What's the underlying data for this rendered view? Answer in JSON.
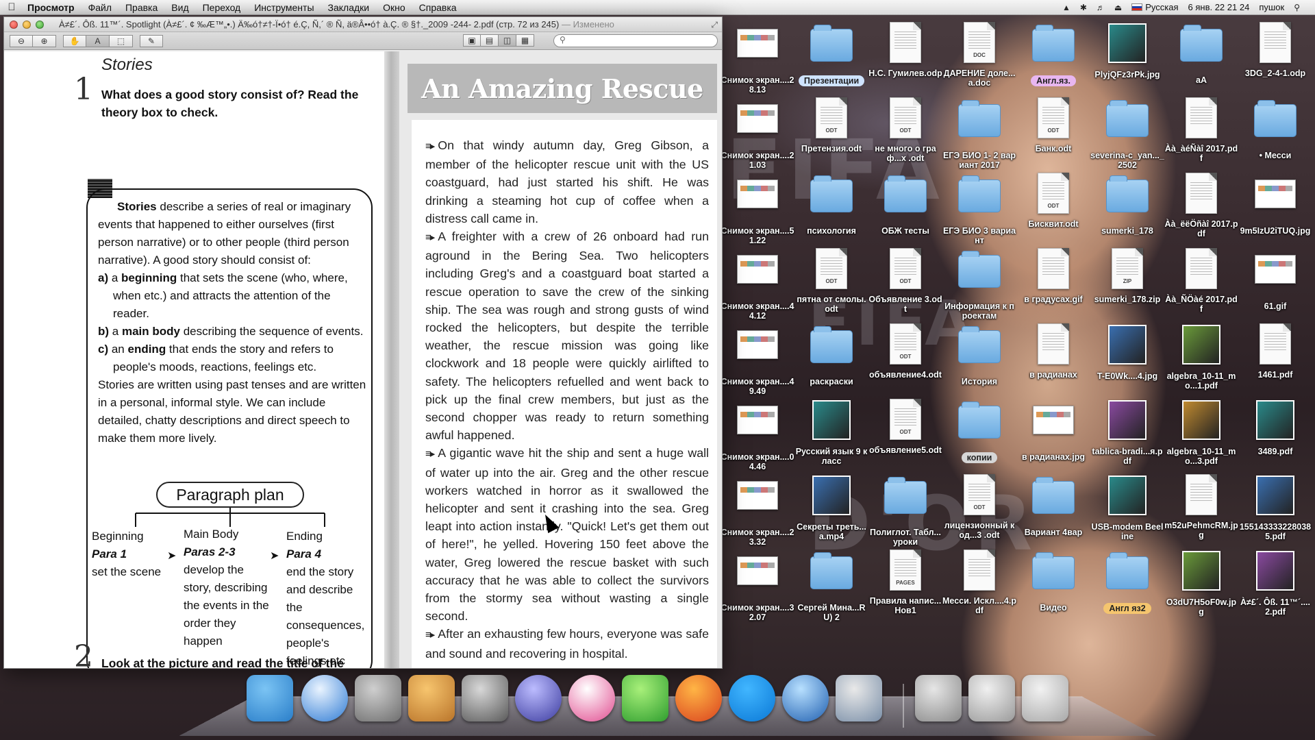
{
  "menubar": {
    "app": "Просмотр",
    "items": [
      "Файл",
      "Правка",
      "Вид",
      "Переход",
      "Инструменты",
      "Закладки",
      "Окно",
      "Справка"
    ],
    "input_source": "Русская",
    "datetime": "6 янв. 22 21 24",
    "user": "пушок"
  },
  "window": {
    "title": "À≠£´. Ôß. 11™´. Spotlight (À≠£´. ¢ ‰Æ™„•.) Ä‰ó†≠†-Ï•ó† é.Ç, Ñ,´ ® Ñ, ä®Â••ó† à.Ç. ® §†._2009 -244- 2.pdf (стр. 72 из 245)",
    "edited": "— Изменено",
    "search_placeholder": ""
  },
  "left_page": {
    "section": "Stories",
    "ex1_num": "1",
    "ex1_text": "What does a good story consist of? Read the theory box to check.",
    "theory": {
      "intro_bold": "Stories",
      "intro": " describe a series of real or imaginary events that happened to either ourselves (first person narrative) or to other people (third person narrative). A good story should consist of:",
      "a_label": "a)",
      "a_pre": " a ",
      "a_bold": "beginning",
      "a_rest": " that sets the scene (who, where, when etc.) and attracts the attention of the reader.",
      "b_label": "b)",
      "b_pre": " a ",
      "b_bold": "main body",
      "b_rest": " describing the sequence of events.",
      "c_label": "c)",
      "c_pre": " an ",
      "c_bold": "ending",
      "c_rest": " that ends the story and refers to people's moods, reactions, feelings etc.",
      "outro": "Stories are written using past tenses and are written in a personal, informal style. We can include detailed, chatty descriptions and direct speech to make them more lively."
    },
    "plan_title": "Paragraph plan",
    "col1": {
      "head": "Beginning",
      "para": "Para 1",
      "desc": "set the scene"
    },
    "col2": {
      "head": "Main Body",
      "para": "Paras 2-3",
      "desc": "develop the story, describing the events in the order they happen"
    },
    "col3": {
      "head": "Ending",
      "para": "Para 4",
      "desc": "end the story and describe the consequences, people's feelings etc"
    },
    "ex2_num": "2",
    "ex2_text": "Look at the picture and read the title of the story and the first paragraph. Where does the"
  },
  "right_page": {
    "title": "An Amazing Rescue",
    "p1": "On that windy autumn day, Greg Gibson, a member of the helicopter rescue unit with the US coastguard, had just started his shift. He was drinking a steaming hot cup of coffee when a distress call came in.",
    "p2": "A freighter with a crew of 26 onboard had run aground in the Bering Sea. Two helicopters including Greg's and a coastguard boat started a rescue operation to save the crew of the sinking ship. The sea was rough and strong gusts of wind rocked the helicopters, but despite the terrible weather, the rescue mission was going like clockwork and 18 people were quickly airlifted to safety. The helicopters refuelled and went back to pick up the final crew members, but just as the second chopper was ready to return something awful happened.",
    "p3": "A gigantic wave hit the ship and sent a huge wall of water up into the air. Greg and the other rescue workers watched in horror as it swallowed the helicopter and sent it crashing into the sea. Greg leapt into action instantly. \"Quick! Let's get them out of here!\", he yelled. Hovering 150 feet above the water, Greg lowered the rescue basket with such accuracy that he was able to collect the survivors from the stormy sea without wasting a single second.",
    "p4": "After an exhausting few hours, everyone was safe and sound and recovering in hospital."
  },
  "desktop_icons": [
    {
      "label": "Снимок экран....28.13",
      "type": "shot"
    },
    {
      "label": "Презентации",
      "type": "folder",
      "tag": "#cfe3ff"
    },
    {
      "label": "Н.С. Гумилев.odp",
      "type": "doc",
      "ext": ""
    },
    {
      "label": "ДАРЕНИЕ доле...a.doc",
      "type": "doc",
      "ext": "DOC"
    },
    {
      "label": "Англ.яз.",
      "type": "folder",
      "tag": "#e8b6f0"
    },
    {
      "label": "PlyjQFz3rPk.jpg",
      "type": "photo"
    },
    {
      "label": "аА",
      "type": "folder"
    },
    {
      "label": "3DG_2-4-1.odp",
      "type": "doc",
      "ext": ""
    },
    {
      "label": "Снимок экран....21.03",
      "type": "shot"
    },
    {
      "label": "Претензия.odt",
      "type": "doc",
      "ext": "ODT"
    },
    {
      "label": "не много о граф...x .odt",
      "type": "doc",
      "ext": "ODT"
    },
    {
      "label": "ЕГЭ БИО 1- 2 вариант 2017",
      "type": "folder"
    },
    {
      "label": "Банк.odt",
      "type": "doc",
      "ext": "ODT"
    },
    {
      "label": "severina-c_yan..._2502",
      "type": "folder"
    },
    {
      "label": "Àà_àéÑàî 2017.pdf",
      "type": "doc",
      "ext": ""
    },
    {
      "label": "• Месси",
      "type": "folder"
    },
    {
      "label": "Снимок экран....51.22",
      "type": "shot"
    },
    {
      "label": "психология",
      "type": "folder"
    },
    {
      "label": "ОБЖ тесты",
      "type": "folder"
    },
    {
      "label": "ЕГЭ БИО 3 вариант",
      "type": "folder"
    },
    {
      "label": "Бисквит.odt",
      "type": "doc",
      "ext": "ODT"
    },
    {
      "label": "sumerki_178",
      "type": "folder"
    },
    {
      "label": "Àà_ëëÖñàî 2017.pdf",
      "type": "doc",
      "ext": ""
    },
    {
      "label": "9m5IzU2iTUQ.jpg",
      "type": "shot"
    },
    {
      "label": "Снимок экран....44.12",
      "type": "shot"
    },
    {
      "label": "пятна от смолы.odt",
      "type": "doc",
      "ext": "ODT"
    },
    {
      "label": "Объявление 3.odt",
      "type": "doc",
      "ext": "ODT"
    },
    {
      "label": "Информация к проектам",
      "type": "folder"
    },
    {
      "label": "в градусах.gif",
      "type": "doc",
      "ext": ""
    },
    {
      "label": "sumerki_178.zip",
      "type": "doc",
      "ext": "ZIP"
    },
    {
      "label": "Àà_ÑÖàé 2017.pdf",
      "type": "doc",
      "ext": ""
    },
    {
      "label": "61.gif",
      "type": "shot"
    },
    {
      "label": "Снимок экран....49.49",
      "type": "shot"
    },
    {
      "label": "раскраски",
      "type": "folder"
    },
    {
      "label": "объявление4.odt",
      "type": "doc",
      "ext": "ODT"
    },
    {
      "label": "История",
      "type": "folder"
    },
    {
      "label": "в радианах",
      "type": "doc",
      "ext": ""
    },
    {
      "label": "T-E0Wk....4.jpg",
      "type": "photo"
    },
    {
      "label": "algebra_10-11_mo...1.pdf",
      "type": "photo"
    },
    {
      "label": "1461.pdf",
      "type": "doc",
      "ext": ""
    },
    {
      "label": "Снимок экран....04.46",
      "type": "shot"
    },
    {
      "label": "Русский язык 9 класс",
      "type": "photo"
    },
    {
      "label": "объявление5.odt",
      "type": "doc",
      "ext": "ODT"
    },
    {
      "label": "копии",
      "type": "folder",
      "tag": "#d6d6d6"
    },
    {
      "label": "в радианах.jpg",
      "type": "shot"
    },
    {
      "label": "tablica-bradi...я.pdf",
      "type": "photo"
    },
    {
      "label": "algebra_10-11_mo...3.pdf",
      "type": "photo"
    },
    {
      "label": "3489.pdf",
      "type": "photo"
    },
    {
      "label": "Снимок экран....23.32",
      "type": "shot"
    },
    {
      "label": "Секреты треть...a.mp4",
      "type": "photo"
    },
    {
      "label": "Полиглот. Табл...уроки",
      "type": "folder"
    },
    {
      "label": "лицензионный код...3 .odt",
      "type": "doc",
      "ext": "ODT"
    },
    {
      "label": "Вариант 4вар",
      "type": "folder"
    },
    {
      "label": "USB-modem Beeline",
      "type": "photo"
    },
    {
      "label": "m52uPehmcRM.jpg",
      "type": "doc",
      "ext": ""
    },
    {
      "label": "1551433332280385.pdf",
      "type": "photo"
    },
    {
      "label": "Снимок экран....32.07",
      "type": "shot"
    },
    {
      "label": "Сергей Мина...RU) 2",
      "type": "folder"
    },
    {
      "label": "Правила напис...Нов1",
      "type": "doc",
      "ext": "PAGES"
    },
    {
      "label": "Месси. Искл....4.pdf",
      "type": "doc",
      "ext": ""
    },
    {
      "label": "Видео",
      "type": "folder"
    },
    {
      "label": "Англ яз2",
      "type": "folder",
      "tag": "#f5c56e"
    },
    {
      "label": "O3dU7H5oF0w.jpg",
      "type": "photo"
    },
    {
      "label": "À≠£´. Ôß. 11™´....2.pdf",
      "type": "photo"
    }
  ],
  "dock": [
    {
      "name": "finder-icon",
      "c1": "#7bc4f4",
      "c2": "#2a7ec9"
    },
    {
      "name": "safari-icon",
      "c1": "#eaf4ff",
      "c2": "#2f7bd4"
    },
    {
      "name": "system-preferences-icon",
      "c1": "#cfcfcf",
      "c2": "#6e6e6e"
    },
    {
      "name": "keynote-icon",
      "c1": "#f7c56e",
      "c2": "#b9742a"
    },
    {
      "name": "preview-icon",
      "c1": "#d8d8d8",
      "c2": "#5a5a5a"
    },
    {
      "name": "launchpad-icon",
      "c1": "#bcbcff",
      "c2": "#3b3b9e"
    },
    {
      "name": "itunes-icon",
      "c1": "#ffffff",
      "c2": "#e14b8f"
    },
    {
      "name": "the-sims-icon",
      "c1": "#a8f07a",
      "c2": "#2f9e2f"
    },
    {
      "name": "firefox-icon",
      "c1": "#ffb545",
      "c2": "#d9411e"
    },
    {
      "name": "skype-icon",
      "c1": "#41b6ff",
      "c2": "#0a78d6"
    },
    {
      "name": "quicktime-icon",
      "c1": "#b8e0ff",
      "c2": "#1f5fb0"
    },
    {
      "name": "iphoto-icon",
      "c1": "#e9e9e9",
      "c2": "#7a8fa8"
    },
    {
      "name": "downloads-stack-icon",
      "c1": "#e6e6e6",
      "c2": "#8a8a8a"
    },
    {
      "name": "documents-stack-icon",
      "c1": "#f0f0f0",
      "c2": "#9a9a9a"
    },
    {
      "name": "trash-icon",
      "c1": "#f2f2f2",
      "c2": "#a8a8a8"
    }
  ]
}
